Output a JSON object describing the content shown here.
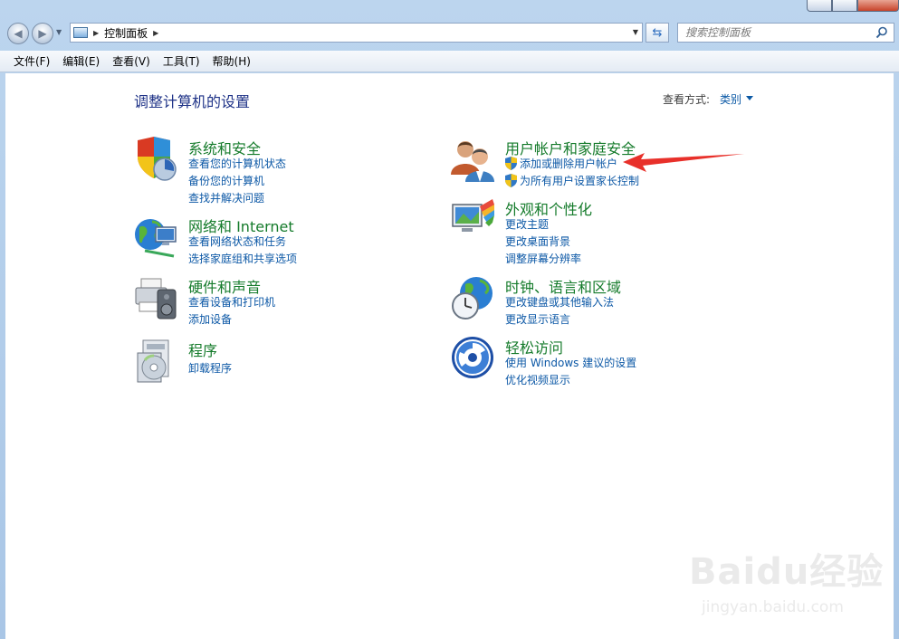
{
  "breadcrumb": {
    "items": [
      "控制面板"
    ]
  },
  "search": {
    "placeholder": "搜索控制面板"
  },
  "menu": {
    "items": [
      "文件(F)",
      "编辑(E)",
      "查看(V)",
      "工具(T)",
      "帮助(H)"
    ]
  },
  "page": {
    "title": "调整计算机的设置",
    "view_by_label": "查看方式:",
    "view_by_value": "类别"
  },
  "categories": [
    {
      "title": "系统和安全",
      "icon": "shield-computer-icon",
      "links": [
        "查看您的计算机状态",
        "备份您的计算机",
        "查找并解决问题"
      ]
    },
    {
      "title": "网络和 Internet",
      "icon": "network-globe-icon",
      "links": [
        "查看网络状态和任务",
        "选择家庭组和共享选项"
      ]
    },
    {
      "title": "硬件和声音",
      "icon": "printer-speaker-icon",
      "links": [
        "查看设备和打印机",
        "添加设备"
      ]
    },
    {
      "title": "程序",
      "icon": "programs-disc-icon",
      "links": [
        "卸载程序"
      ]
    },
    {
      "title": "用户帐户和家庭安全",
      "icon": "users-icon",
      "links": [
        "添加或删除用户帐户",
        "为所有用户设置家长控制"
      ]
    },
    {
      "title": "外观和个性化",
      "icon": "monitor-paint-icon",
      "links": [
        "更改主题",
        "更改桌面背景",
        "调整屏幕分辨率"
      ]
    },
    {
      "title": "时钟、语言和区域",
      "icon": "globe-clock-icon",
      "links": [
        "更改键盘或其他输入法",
        "更改显示语言"
      ]
    },
    {
      "title": "轻松访问",
      "icon": "ease-of-access-icon",
      "links": [
        "使用 Windows 建议的设置",
        "优化视频显示"
      ]
    }
  ],
  "watermark": {
    "logo": "Baidu经验",
    "site": "jingyan.baidu.com"
  },
  "colors": {
    "title_blue": "#1e3287",
    "category_green": "#157b2b",
    "link_blue": "#0c58a6",
    "annotation_red": "#e8302a"
  }
}
